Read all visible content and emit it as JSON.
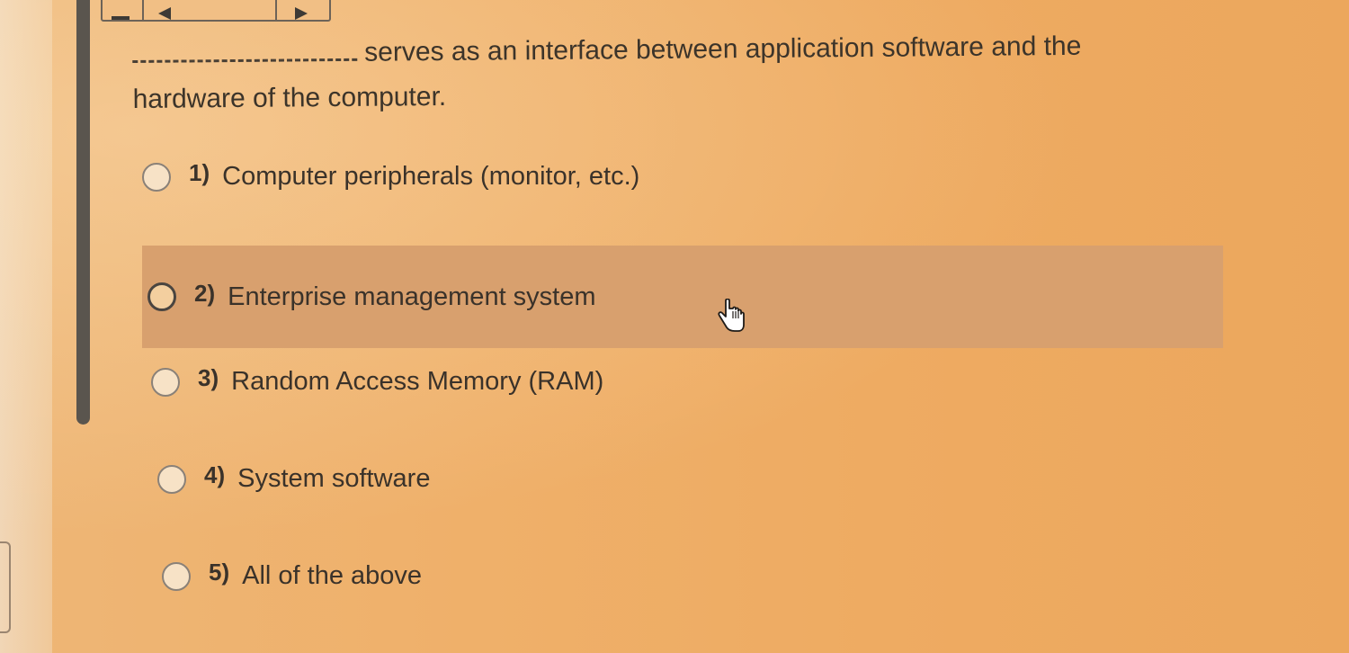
{
  "toolbar": {
    "menu_icon": "menu-icon",
    "listen_icon": "speaker-icon",
    "play_icon": "play-icon"
  },
  "question": {
    "blank": "_______________",
    "text_part1": "serves as an interface between application software and the",
    "text_part2": "hardware of the computer."
  },
  "options": [
    {
      "number": "1)",
      "label": "Computer peripherals (monitor, etc.)"
    },
    {
      "number": "2)",
      "label": "Enterprise management system"
    },
    {
      "number": "3)",
      "label": "Random Access Memory (RAM)"
    },
    {
      "number": "4)",
      "label": "System software"
    },
    {
      "number": "5)",
      "label": "All of the above"
    }
  ],
  "colors": {
    "background": "#efb06a",
    "hover_row": "#d8a06e",
    "scrollbar": "#5a554e"
  },
  "cursor": "hand-pointer-icon"
}
